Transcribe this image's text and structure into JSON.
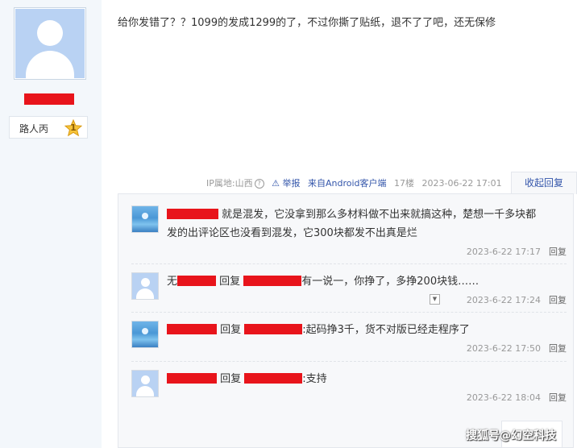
{
  "poster": {
    "level_name": "路人丙",
    "level_num": "1"
  },
  "post": {
    "content": "给你发错了？？1099的发成1299的了，不过你撕了贴纸，退不了了吧，还无保修",
    "ip_label": "IP属地:山西",
    "ip_help": "?",
    "report_label": "举报",
    "client_label": "来自Android客户端",
    "floor": "17楼",
    "time": "2023-06-22 17:01",
    "collapse_label": "收起回复"
  },
  "replies": [
    {
      "text1": " 就是混发，它没拿到那么多材料做不出来就搞这种，楚想一千多块都",
      "text2": "发的出评论区也没看到混发，它300块都发不出真是烂",
      "time": "2023-6-22 17:17",
      "reply_label": "回复"
    },
    {
      "prefix": "无",
      "reply_word": " 回复 ",
      "content": "有一说一，你挣了，多挣200块钱……",
      "time": "2023-6-22 17:24",
      "reply_label": "回复"
    },
    {
      "reply_word": " 回复 ",
      "content": ":起码挣3千，货不对版已经走程序了",
      "time": "2023-6-22 17:50",
      "reply_label": "回复"
    },
    {
      "reply_word": " 回复 ",
      "content": ":支持",
      "time": "2023-6-22 18:04",
      "reply_label": "回复"
    }
  ],
  "watermark": "搜狐号@幻空科技",
  "colors": {
    "redact": "#e8141b",
    "link": "#3355aa"
  }
}
